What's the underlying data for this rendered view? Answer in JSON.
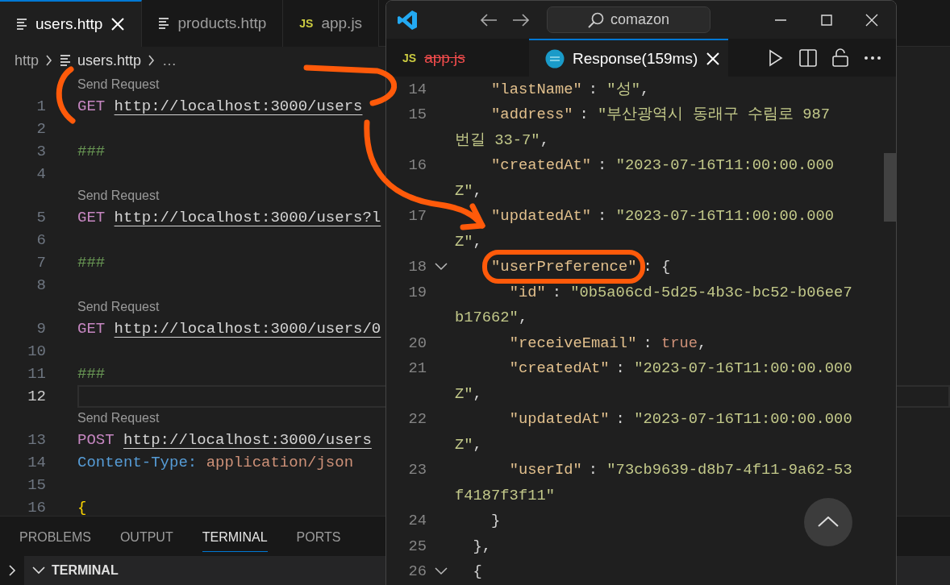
{
  "editor": {
    "tabs": [
      {
        "kind": "file",
        "label": "users.http",
        "selected": true
      },
      {
        "kind": "file",
        "label": "products.http",
        "selected": false
      },
      {
        "kind": "js",
        "icon_text": "JS",
        "label": "app.js",
        "selected": false
      }
    ],
    "breadcrumb": [
      {
        "kind": "text",
        "label": "http"
      },
      {
        "kind": "file",
        "label": "users.http"
      },
      {
        "kind": "text",
        "label": "…"
      }
    ],
    "lines": [
      {
        "kind": "lens",
        "text": "Send Request"
      },
      {
        "kind": "code",
        "number": "1",
        "current": false,
        "tokens": [
          {
            "kind": "method",
            "text": "GET"
          },
          {
            "kind": "url",
            "text": "http://localhost:3000/users"
          }
        ]
      },
      {
        "kind": "code",
        "number": "2",
        "current": false
      },
      {
        "kind": "code",
        "number": "3",
        "current": false,
        "tokens": [
          {
            "kind": "comment",
            "text": "###"
          }
        ]
      },
      {
        "kind": "code",
        "number": "4",
        "current": false
      },
      {
        "kind": "lens",
        "text": "Send Request"
      },
      {
        "kind": "code",
        "number": "5",
        "current": false,
        "tokens": [
          {
            "kind": "method",
            "text": "GET"
          },
          {
            "kind": "url",
            "text": "http://localhost:3000/users?l"
          }
        ]
      },
      {
        "kind": "code",
        "number": "6",
        "current": false
      },
      {
        "kind": "code",
        "number": "7",
        "current": false,
        "tokens": [
          {
            "kind": "comment",
            "text": "###"
          }
        ]
      },
      {
        "kind": "code",
        "number": "8",
        "current": false
      },
      {
        "kind": "lens",
        "text": "Send Request"
      },
      {
        "kind": "code",
        "number": "9",
        "current": false,
        "tokens": [
          {
            "kind": "method",
            "text": "GET"
          },
          {
            "kind": "url",
            "text": "http://localhost:3000/users/0"
          }
        ]
      },
      {
        "kind": "code",
        "number": "10",
        "current": false
      },
      {
        "kind": "code",
        "number": "11",
        "current": false,
        "tokens": [
          {
            "kind": "comment",
            "text": "###"
          }
        ]
      },
      {
        "kind": "code",
        "number": "12",
        "current": true
      },
      {
        "kind": "lens",
        "text": "Send Request"
      },
      {
        "kind": "code",
        "number": "13",
        "current": false,
        "tokens": [
          {
            "kind": "method",
            "text": "POST"
          },
          {
            "kind": "url",
            "text": "http://localhost:3000/users"
          }
        ]
      },
      {
        "kind": "code",
        "number": "14",
        "current": false,
        "tokens": [
          {
            "kind": "header",
            "text": "Content-Type:"
          },
          {
            "kind": "value",
            "text": "application/json"
          }
        ]
      },
      {
        "kind": "code",
        "number": "15",
        "current": false
      },
      {
        "kind": "code",
        "number": "16",
        "current": false,
        "tokens": [
          {
            "kind": "brace",
            "text": "{"
          }
        ]
      }
    ]
  },
  "panel": {
    "tabs": [
      {
        "label": "PROBLEMS",
        "selected": false
      },
      {
        "label": "OUTPUT",
        "selected": false
      },
      {
        "label": "TERMINAL",
        "selected": true
      },
      {
        "label": "PORTS",
        "selected": false
      }
    ],
    "section": {
      "label": "TERMINAL",
      "expanded": true
    }
  },
  "window": {
    "search": "comazon",
    "tabs": [
      {
        "kind": "js",
        "icon_text": "JS",
        "label": "app.js",
        "deleted": true,
        "selected": false
      },
      {
        "kind": "response",
        "label": "Response(159ms)",
        "selected": true
      }
    ],
    "rows": [
      {
        "number": "14",
        "tokens": [
          {
            "kind": "key",
            "text": "    \"lastName\""
          },
          {
            "kind": "punct",
            "text": ": "
          },
          {
            "kind": "string",
            "text": "\"성\""
          },
          {
            "kind": "punct",
            "text": ","
          }
        ]
      },
      {
        "number": "15",
        "tokens": [
          {
            "kind": "key",
            "text": "    \"address\""
          },
          {
            "kind": "punct",
            "text": ": "
          },
          {
            "kind": "string",
            "text": "\"부산광역시 동래구 수림로 987"
          }
        ]
      },
      {
        "tokens": [
          {
            "kind": "string",
            "text": "번길 33-7\""
          },
          {
            "kind": "punct",
            "text": ","
          }
        ]
      },
      {
        "number": "16",
        "tokens": [
          {
            "kind": "key",
            "text": "    \"createdAt\""
          },
          {
            "kind": "punct",
            "text": ": "
          },
          {
            "kind": "string",
            "text": "\"2023-07-16T11:00:00.000"
          }
        ]
      },
      {
        "tokens": [
          {
            "kind": "string",
            "text": "Z\""
          },
          {
            "kind": "punct",
            "text": ","
          }
        ]
      },
      {
        "number": "17",
        "tokens": [
          {
            "kind": "key",
            "text": "    \"updatedAt\""
          },
          {
            "kind": "punct",
            "text": ": "
          },
          {
            "kind": "string",
            "text": "\"2023-07-16T11:00:00.000"
          }
        ]
      },
      {
        "tokens": [
          {
            "kind": "string",
            "text": "Z\""
          },
          {
            "kind": "punct",
            "text": ","
          }
        ]
      },
      {
        "number": "18",
        "expanded": true,
        "tokens": [
          {
            "kind": "key",
            "text": "    \"userPreference\""
          },
          {
            "kind": "punct",
            "text": ": {"
          }
        ]
      },
      {
        "number": "19",
        "tokens": [
          {
            "kind": "key",
            "text": "      \"id\""
          },
          {
            "kind": "punct",
            "text": ": "
          },
          {
            "kind": "string",
            "text": "\"0b5a06cd-5d25-4b3c-bc52-b06ee7"
          }
        ]
      },
      {
        "tokens": [
          {
            "kind": "string",
            "text": "b17662\""
          },
          {
            "kind": "punct",
            "text": ","
          }
        ]
      },
      {
        "number": "20",
        "tokens": [
          {
            "kind": "key",
            "text": "      \"receiveEmail\""
          },
          {
            "kind": "punct",
            "text": ": "
          },
          {
            "kind": "bool",
            "text": "true"
          },
          {
            "kind": "punct",
            "text": ","
          }
        ]
      },
      {
        "number": "21",
        "tokens": [
          {
            "kind": "key",
            "text": "      \"createdAt\""
          },
          {
            "kind": "punct",
            "text": ": "
          },
          {
            "kind": "string",
            "text": "\"2023-07-16T11:00:00.000"
          }
        ]
      },
      {
        "tokens": [
          {
            "kind": "string",
            "text": "Z\""
          },
          {
            "kind": "punct",
            "text": ","
          }
        ]
      },
      {
        "number": "22",
        "tokens": [
          {
            "kind": "key",
            "text": "      \"updatedAt\""
          },
          {
            "kind": "punct",
            "text": ": "
          },
          {
            "kind": "string",
            "text": "\"2023-07-16T11:00:00.000"
          }
        ]
      },
      {
        "tokens": [
          {
            "kind": "string",
            "text": "Z\""
          },
          {
            "kind": "punct",
            "text": ","
          }
        ]
      },
      {
        "number": "23",
        "tokens": [
          {
            "kind": "key",
            "text": "      \"userId\""
          },
          {
            "kind": "punct",
            "text": ": "
          },
          {
            "kind": "string",
            "text": "\"73cb9639-d8b7-4f11-9a62-53"
          }
        ]
      },
      {
        "tokens": [
          {
            "kind": "string",
            "text": "f4187f3f11\""
          }
        ]
      },
      {
        "number": "24",
        "tokens": [
          {
            "kind": "punct",
            "text": "    }"
          }
        ]
      },
      {
        "number": "25",
        "tokens": [
          {
            "kind": "punct",
            "text": "  },"
          }
        ]
      },
      {
        "number": "26",
        "expanded": true,
        "tokens": [
          {
            "kind": "punct",
            "text": "  {"
          }
        ]
      }
    ]
  }
}
